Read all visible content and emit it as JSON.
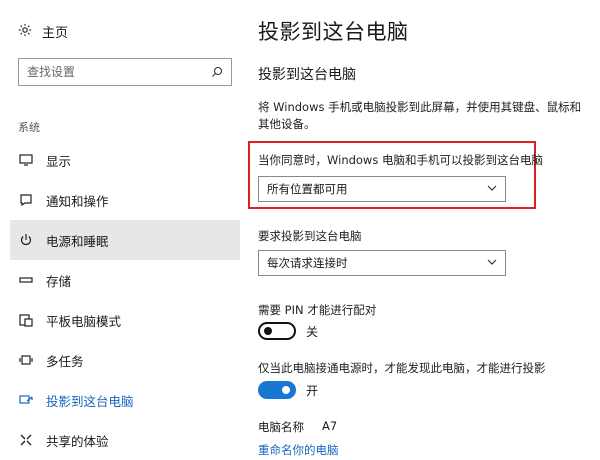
{
  "sidebar": {
    "home_label": "主页",
    "search_placeholder": "查找设置",
    "section_label": "系统",
    "items": [
      {
        "label": "显示",
        "icon": "monitor-icon"
      },
      {
        "label": "通知和操作",
        "icon": "notification-icon"
      },
      {
        "label": "电源和睡眠",
        "icon": "power-icon"
      },
      {
        "label": "存储",
        "icon": "storage-icon"
      },
      {
        "label": "平板电脑模式",
        "icon": "tablet-mode-icon"
      },
      {
        "label": "多任务",
        "icon": "multitask-icon"
      },
      {
        "label": "投影到这台电脑",
        "icon": "project-icon"
      },
      {
        "label": "共享的体验",
        "icon": "shared-experience-icon"
      }
    ]
  },
  "main": {
    "page_title": "投影到这台电脑",
    "sub_title": "投影到这台电脑",
    "description": "将 Windows 手机或电脑投影到此屏幕，并使用其键盘、鼠标和其他设备。",
    "availability": {
      "label": "当你同意时，Windows 电脑和手机可以投影到这台电脑",
      "selected": "所有位置都可用"
    },
    "request": {
      "label": "要求投影到这台电脑",
      "selected": "每次请求连接时"
    },
    "pin": {
      "label": "需要 PIN 才能进行配对",
      "state_label": "关"
    },
    "power": {
      "label": "仅当此电脑接通电源时，才能发现此电脑，才能进行投影",
      "state_label": "开"
    },
    "pc_name": {
      "label": "电脑名称",
      "value": "A7"
    },
    "rename_link": "重命名你的电脑"
  },
  "colors": {
    "accent": "#1976d2",
    "link": "#1565c0",
    "highlight_border": "#e02020",
    "active_bg": "#e7e7e7"
  }
}
